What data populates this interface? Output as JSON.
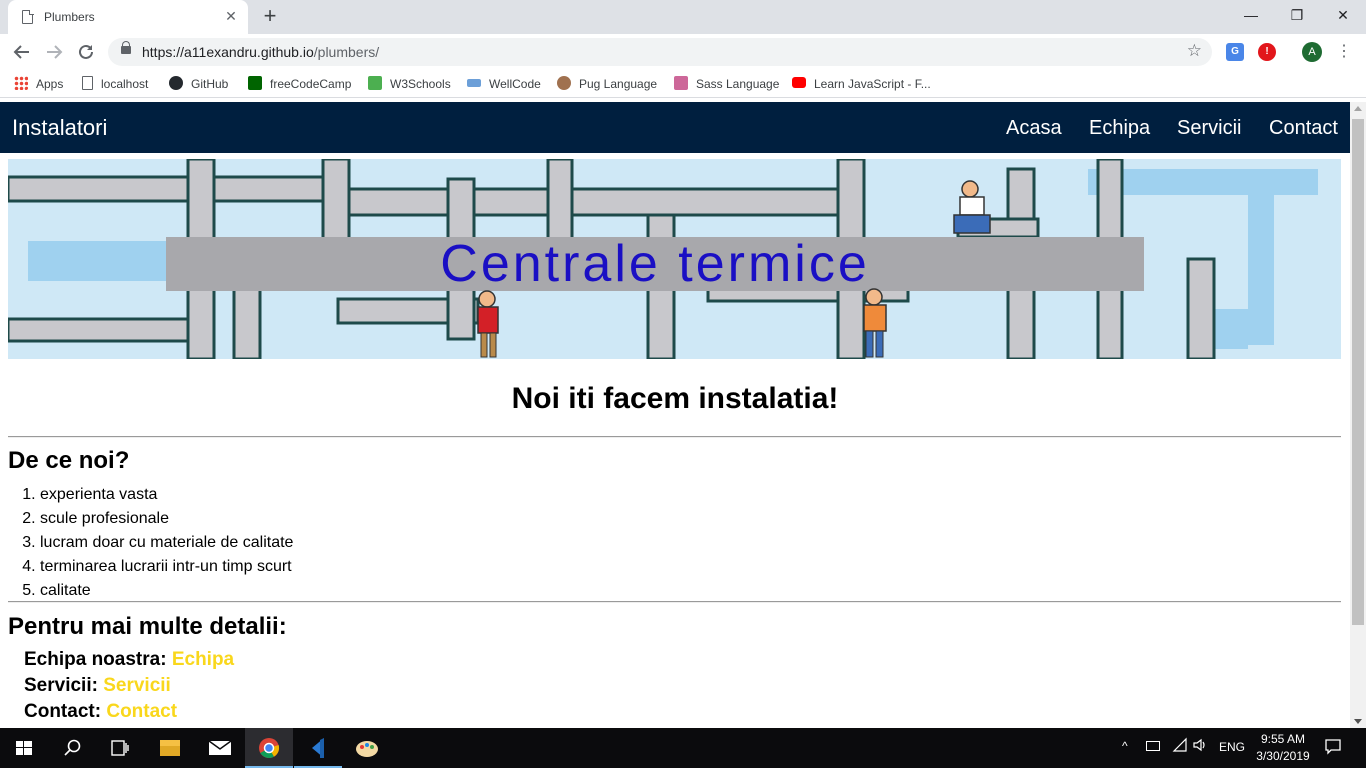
{
  "browser": {
    "tab_title": "Plumbers",
    "tab_close": "✕",
    "new_tab": "+",
    "window_minimize": "—",
    "window_restore": "❐",
    "window_close": "✕",
    "url_host": "https://a11exandru.github.io",
    "url_path": "/plumbers/",
    "star": "☆",
    "menu": "⋮",
    "avatar_letter": "A",
    "bookmarks": [
      {
        "label": "Apps",
        "icon": "apps-grid-icon"
      },
      {
        "label": "localhost",
        "icon": "page-icon"
      },
      {
        "label": "GitHub",
        "icon": "github-icon"
      },
      {
        "label": "freeCodeCamp",
        "icon": "freecodecamp-icon"
      },
      {
        "label": "W3Schools",
        "icon": "w3schools-icon"
      },
      {
        "label": "WellCode",
        "icon": "wellcode-icon"
      },
      {
        "label": "Pug Language",
        "icon": "pug-icon"
      },
      {
        "label": "Sass Language",
        "icon": "sass-icon"
      },
      {
        "label": "Learn JavaScript - F...",
        "icon": "youtube-icon"
      }
    ]
  },
  "site": {
    "brand": "Instalatori",
    "nav": [
      "Acasa",
      "Echipa",
      "Servicii",
      "Contact"
    ],
    "hero_text": "Centrale termice",
    "headline": "Noi iti facem instalatia!",
    "why_title": "De ce noi?",
    "reasons": [
      "experienta vasta",
      "scule profesionale",
      "lucram doar cu materiale de calitate",
      "terminarea lucrarii intr-un timp scurt",
      "calitate"
    ],
    "more_title": "Pentru mai multe detalii:",
    "details": [
      {
        "label": "Echipa noastra:",
        "link": "Echipa"
      },
      {
        "label": "Servicii:",
        "link": "Servicii"
      },
      {
        "label": "Contact:",
        "link": "Contact"
      }
    ],
    "colors": {
      "nav_bg": "#001f3f",
      "link": "#f9d71c",
      "hero_text": "#1a0fc4"
    }
  },
  "taskbar": {
    "language": "ENG",
    "time": "9:55 AM",
    "date": "3/30/2019"
  }
}
